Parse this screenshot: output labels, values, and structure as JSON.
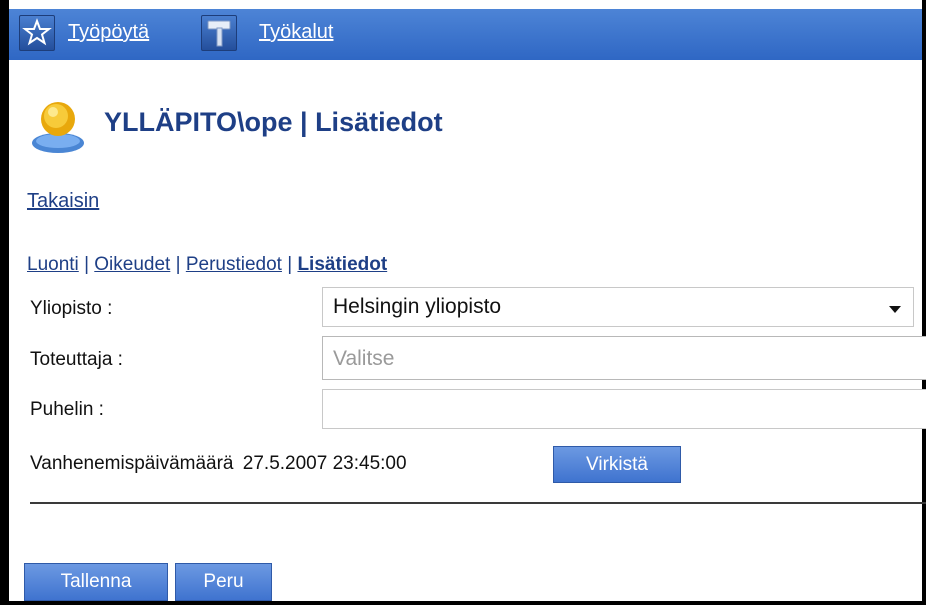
{
  "topbar": {
    "desktop_label": "Työpöytä",
    "tools_label": "Työkalut",
    "icons": [
      "star-icon",
      "hammer-icon"
    ],
    "bg_color": "#3a72cc"
  },
  "page": {
    "title": "YLLÄPITO\\ope | Lisätiedot",
    "user_icon": "user-icon",
    "back_link": "Takaisin"
  },
  "tabs": {
    "items": [
      "Luonti",
      "Oikeudet",
      "Perustiedot",
      "Lisätiedot"
    ],
    "separator": "|",
    "active": "Lisätiedot"
  },
  "form": {
    "yliopisto": {
      "label": "Yliopisto :",
      "value": "Helsingin yliopisto"
    },
    "toteuttaja": {
      "label": "Toteuttaja :",
      "placeholder": "Valitse"
    },
    "puhelin": {
      "label": "Puhelin :",
      "value": ""
    },
    "expiry": {
      "label": "Vanhenemispäivämäärä",
      "value": "27.5.2007 23:45:00"
    },
    "refresh_label": "Virkistä"
  },
  "actions": {
    "save_label": "Tallenna",
    "cancel_label": "Peru"
  }
}
